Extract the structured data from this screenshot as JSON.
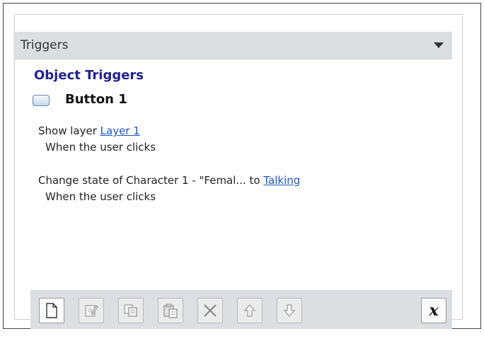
{
  "panel": {
    "title": "Triggers"
  },
  "section": {
    "title": "Object Triggers"
  },
  "object": {
    "name": "Button 1"
  },
  "triggers": [
    {
      "action": "Show layer",
      "target": "Layer 1",
      "condition": "When the user clicks"
    },
    {
      "action": "Change state of Character 1 - \"Femal...",
      "joiner": "to",
      "target": "Talking",
      "condition": "When the user clicks"
    }
  ],
  "toolbar": {
    "buttons": [
      "new-trigger-icon",
      "edit-trigger-icon",
      "copy-icon",
      "paste-icon",
      "delete-icon",
      "move-up-icon",
      "move-down-icon"
    ],
    "close_label": "x"
  },
  "colors": {
    "header": "#dcdee1",
    "section_title": "#1f1f8f",
    "link": "#1f56c4"
  }
}
